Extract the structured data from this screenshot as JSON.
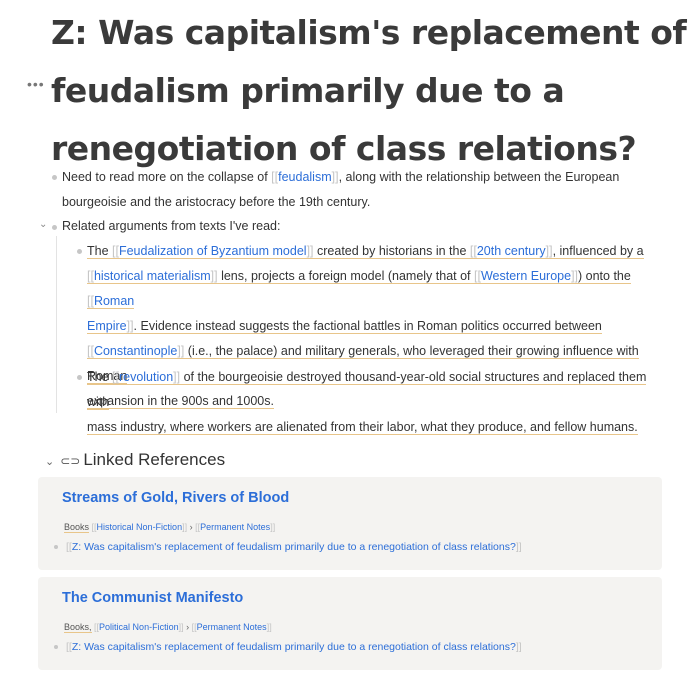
{
  "page": {
    "title": "Z: Was capitalism's replacement of feudalism primarily due to a renegotiation of class relations?",
    "title_menu_icon": "more-horizontal-icon"
  },
  "blocks": {
    "b1": {
      "t1": "Need to read more on the collapse of ",
      "link_feudalism": "feudalism",
      "t2": ", along with the relationship between the European",
      "t3": "bourgeoisie and the aristocracy before the 19th century."
    },
    "b2": {
      "text": "Related arguments from texts I've read:"
    },
    "b2a": {
      "t1": "The ",
      "l1": "Feudalization of Byzantium model",
      "t2": " created by historians in the ",
      "l2": "20th century",
      "t3": ", influenced by a",
      "l3": "historical materialism",
      "t4": " lens, projects a foreign model (namely that of ",
      "l4": "Western Europe",
      "t5": ") onto the ",
      "l5a": "Roman",
      "l5b": "Empire",
      "t6": ". Evidence instead suggests the factional battles in Roman politics occurred between",
      "l6": "Constantinople",
      "t7": " (i.e., the palace) and military generals, who leveraged their growing influence with Roman",
      "t8": "expansion in the 900s and 1000s."
    },
    "b2b": {
      "t1": "The ",
      "l1": "revolution",
      "t2": " of the bourgeoisie destroyed thousand-year-old social structures and replaced them with",
      "t3": "mass industry, where workers are alienated from their labor, what they produce, and fellow humans."
    }
  },
  "linked_refs": {
    "heading": "Linked References",
    "chevron_icon": "chevron-down-icon",
    "link_icon": "link-icon",
    "refs": [
      {
        "title": "Streams of Gold, Rivers of Blood",
        "tag_books": "Books",
        "tag_a": "Historical Non-Fiction",
        "tag_sep": "›",
        "tag_b": "Permanent Notes",
        "item": "Z: Was capitalism's replacement of feudalism primarily due to a renegotiation of class relations?"
      },
      {
        "title": "The Communist Manifesto",
        "tag_books": "Books,",
        "tag_a": "Political Non-Fiction",
        "tag_sep": "›",
        "tag_b": "Permanent Notes",
        "item": "Z: Was capitalism's replacement of feudalism primarily due to a renegotiation of class relations?"
      }
    ]
  },
  "colors": {
    "link": "#2c6ed8",
    "underline": "#e8c58a",
    "card_bg": "#f4f3f1",
    "title": "#3a3a3a"
  }
}
